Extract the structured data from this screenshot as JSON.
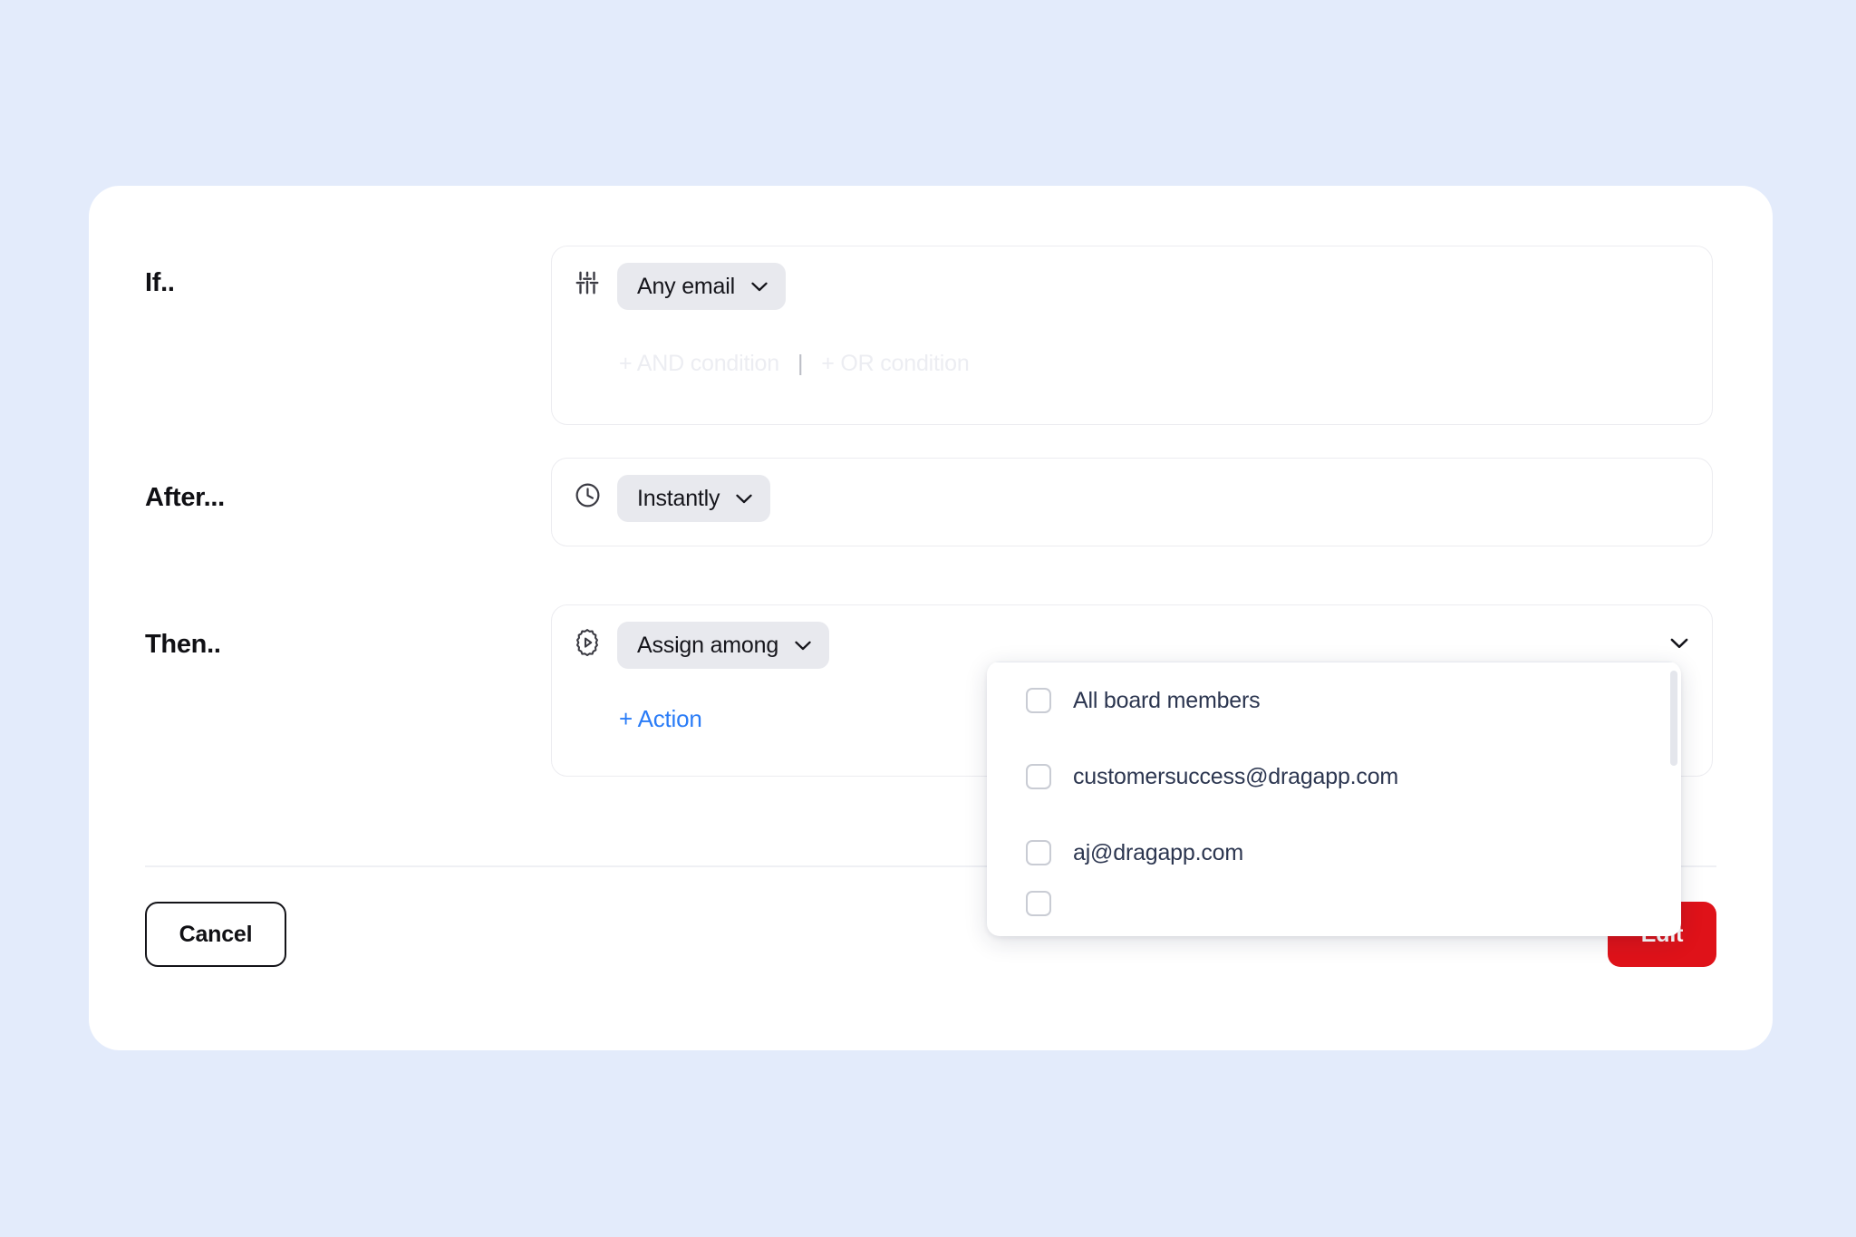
{
  "theme": {
    "page_background": "#e3ebfb",
    "card_background": "#ffffff",
    "accent_blue": "#2a7cf7",
    "danger_red": "#df1219",
    "pill_background": "#e8e9ee",
    "muted_text": "#ecedf2"
  },
  "rows": {
    "if": {
      "label": "If..",
      "icon": "sliders-icon",
      "condition_value": "Any email",
      "add_and_label": "+ AND condition",
      "separator": "|",
      "add_or_label": "+ OR condition"
    },
    "after": {
      "label": "After...",
      "icon": "clock-icon",
      "delay_value": "Instantly"
    },
    "then": {
      "label": "Then..",
      "icon": "automation-gear-icon",
      "action_value": "Assign among",
      "assignee_value": "",
      "add_action_label": "+ Action"
    }
  },
  "assignee_dropdown": {
    "options": [
      {
        "label": "All board members",
        "checked": false
      },
      {
        "label": "customersuccess@dragapp.com",
        "checked": false
      },
      {
        "label": "aj@dragapp.com",
        "checked": false
      }
    ]
  },
  "footer": {
    "cancel_label": "Cancel",
    "edit_label": "Edit"
  }
}
